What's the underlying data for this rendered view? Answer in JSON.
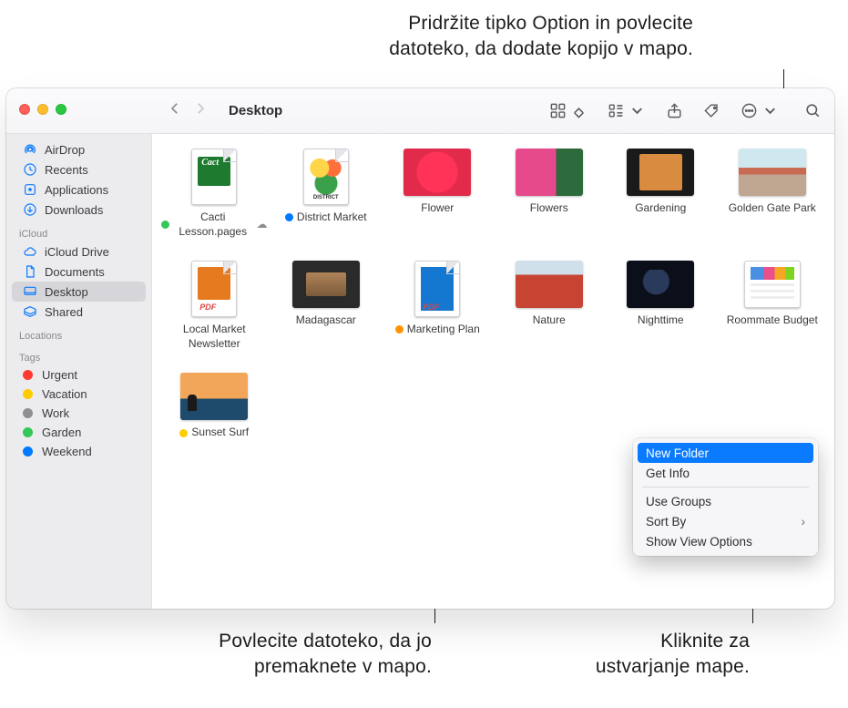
{
  "callouts": {
    "top": "Pridržite tipko Option in povlecite\ndatoteko, da dodate kopijo v mapo.",
    "bottom_left": "Povlecite datoteko, da jo\npremaknete v mapo.",
    "bottom_right": "Kliknite za\nustvarjanje mape."
  },
  "window": {
    "location": "Desktop"
  },
  "sidebar": {
    "favorites": [
      {
        "icon": "airdrop",
        "label": "AirDrop"
      },
      {
        "icon": "recents",
        "label": "Recents"
      },
      {
        "icon": "apps",
        "label": "Applications"
      },
      {
        "icon": "downloads",
        "label": "Downloads"
      }
    ],
    "icloud_header": "iCloud",
    "icloud": [
      {
        "icon": "icloud",
        "label": "iCloud Drive"
      },
      {
        "icon": "doc",
        "label": "Documents"
      },
      {
        "icon": "desktop",
        "label": "Desktop",
        "selected": true
      },
      {
        "icon": "shared",
        "label": "Shared"
      }
    ],
    "locations_header": "Locations",
    "tags_header": "Tags",
    "tags": [
      {
        "color": "#ff3b30",
        "label": "Urgent"
      },
      {
        "color": "#ffcc00",
        "label": "Vacation"
      },
      {
        "color": "#8e8e93",
        "label": "Work"
      },
      {
        "color": "#34c759",
        "label": "Garden"
      },
      {
        "color": "#007aff",
        "label": "Weekend"
      }
    ]
  },
  "files": [
    {
      "name": "Cacti Lesson.pages",
      "cloud": true,
      "tag": "#34c759",
      "thumb": "doc p-cacti"
    },
    {
      "name": "District Market",
      "tag": "#007aff",
      "thumb": "doc p-district"
    },
    {
      "name": "Flower",
      "thumb": "p-flower"
    },
    {
      "name": "Flowers",
      "thumb": "p-flowers"
    },
    {
      "name": "Gardening",
      "thumb": "p-gardening"
    },
    {
      "name": "Golden Gate Park",
      "thumb": "p-golden"
    },
    {
      "name": "Local Market Newsletter",
      "thumb": "doc p-newsletter"
    },
    {
      "name": "Madagascar",
      "thumb": "p-madagascar"
    },
    {
      "name": "Marketing Plan",
      "tag": "#ff9500",
      "thumb": "doc p-marketing"
    },
    {
      "name": "Nature",
      "thumb": "p-nature"
    },
    {
      "name": "Nighttime",
      "thumb": "p-night"
    },
    {
      "name": "Roommate Budget",
      "thumb": "sheet p-budget"
    },
    {
      "name": "Sunset Surf",
      "tag": "#ffcc00",
      "thumb": "p-sunset"
    }
  ],
  "context_menu": {
    "items": [
      {
        "label": "New Folder",
        "selected": true
      },
      {
        "label": "Get Info"
      },
      {
        "sep": true
      },
      {
        "label": "Use Groups"
      },
      {
        "label": "Sort By",
        "submenu": true
      },
      {
        "label": "Show View Options"
      }
    ]
  }
}
